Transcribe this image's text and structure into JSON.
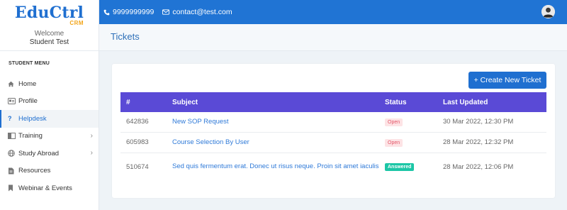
{
  "brand": {
    "logo_main": "EduCtrl",
    "logo_sub": "CRM"
  },
  "user": {
    "welcome": "Welcome",
    "name": "Student Test"
  },
  "topbar": {
    "phone": "9999999999",
    "email": "contact@test.com"
  },
  "sidebar": {
    "title": "STUDENT MENU",
    "items": [
      {
        "label": "Home",
        "icon": "home-icon"
      },
      {
        "label": "Profile",
        "icon": "id-card-icon"
      },
      {
        "label": "Helpdesk",
        "icon": "question-icon",
        "active": true
      },
      {
        "label": "Training",
        "icon": "presentation-icon",
        "has_children": true
      },
      {
        "label": "Study Abroad",
        "icon": "globe-icon",
        "has_children": true
      },
      {
        "label": "Resources",
        "icon": "document-icon"
      },
      {
        "label": "Webinar & Events",
        "icon": "bookmark-icon"
      }
    ]
  },
  "page": {
    "title": "Tickets",
    "create_button": "+ Create New Ticket"
  },
  "table": {
    "headers": [
      "#",
      "Subject",
      "Status",
      "Last Updated"
    ],
    "rows": [
      {
        "id": "642836",
        "subject": "New SOP Request",
        "status": "Open",
        "updated": "30 Mar 2022, 12:30 PM"
      },
      {
        "id": "605983",
        "subject": "Course Selection By User",
        "status": "Open",
        "updated": "28 Mar 2022, 12:32 PM"
      },
      {
        "id": "510674",
        "subject": "Sed quis fermentum erat. Donec ut risus neque. Proin sit amet iaculis",
        "status": "Answered",
        "updated": "28 Mar 2022, 12:06 PM"
      }
    ]
  },
  "colors": {
    "primary": "#1f6fd0",
    "table_header": "#5a4ad6",
    "open_badge": "#fde3e5",
    "answered_badge": "#1cc6a6"
  }
}
